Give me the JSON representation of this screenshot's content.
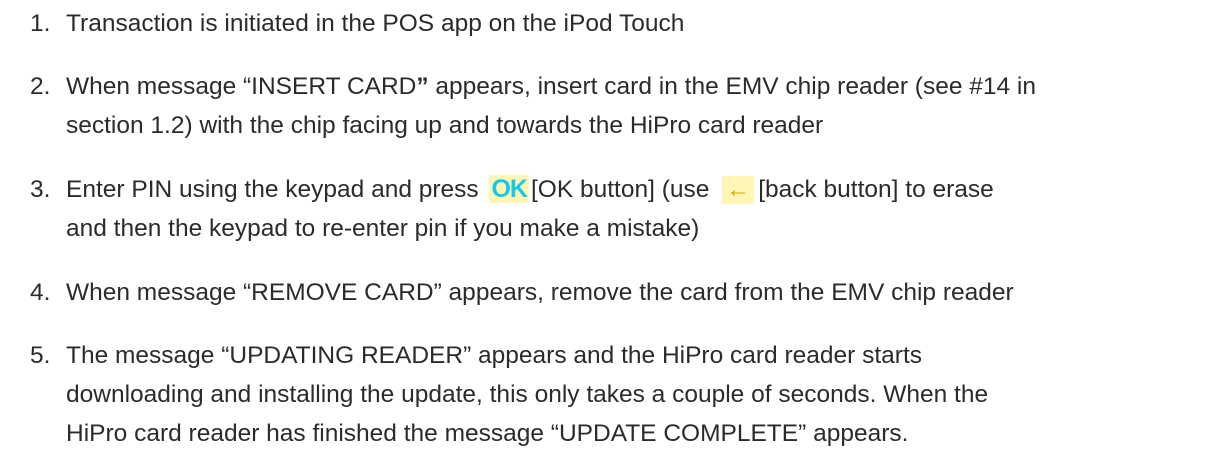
{
  "steps": [
    {
      "number": "1.",
      "text": "Transaction is initiated in the POS app on the iPod Touch"
    },
    {
      "number": "2.",
      "line1_pre": "When message “INSERT CARD",
      "line1_quote": "”",
      "line1_post": " appears, insert card in the EMV chip reader (see #14 in",
      "line2": "section 1.2)  with the chip facing up and towards the HiPro card reader"
    },
    {
      "number": "3.",
      "line1_pre": "Enter PIN using the keypad and press ",
      "ok_icon_label": "OK",
      "line1_mid": "[OK button] (use ",
      "back_icon_glyph": "←",
      "line1_post": "[back button] to erase",
      "line2": "and then the keypad to re-enter pin if you make a mistake)"
    },
    {
      "number": "4.",
      "text": "When message “REMOVE CARD” appears, remove the card from the EMV chip reader"
    },
    {
      "number": "5.",
      "line1": "The message “UPDATING READER” appears and the HiPro card reader starts",
      "line2": "downloading and installing the update, this only takes a couple of seconds. When the",
      "line3": "HiPro card reader has finished the message “UPDATE COMPLETE” appears."
    }
  ]
}
